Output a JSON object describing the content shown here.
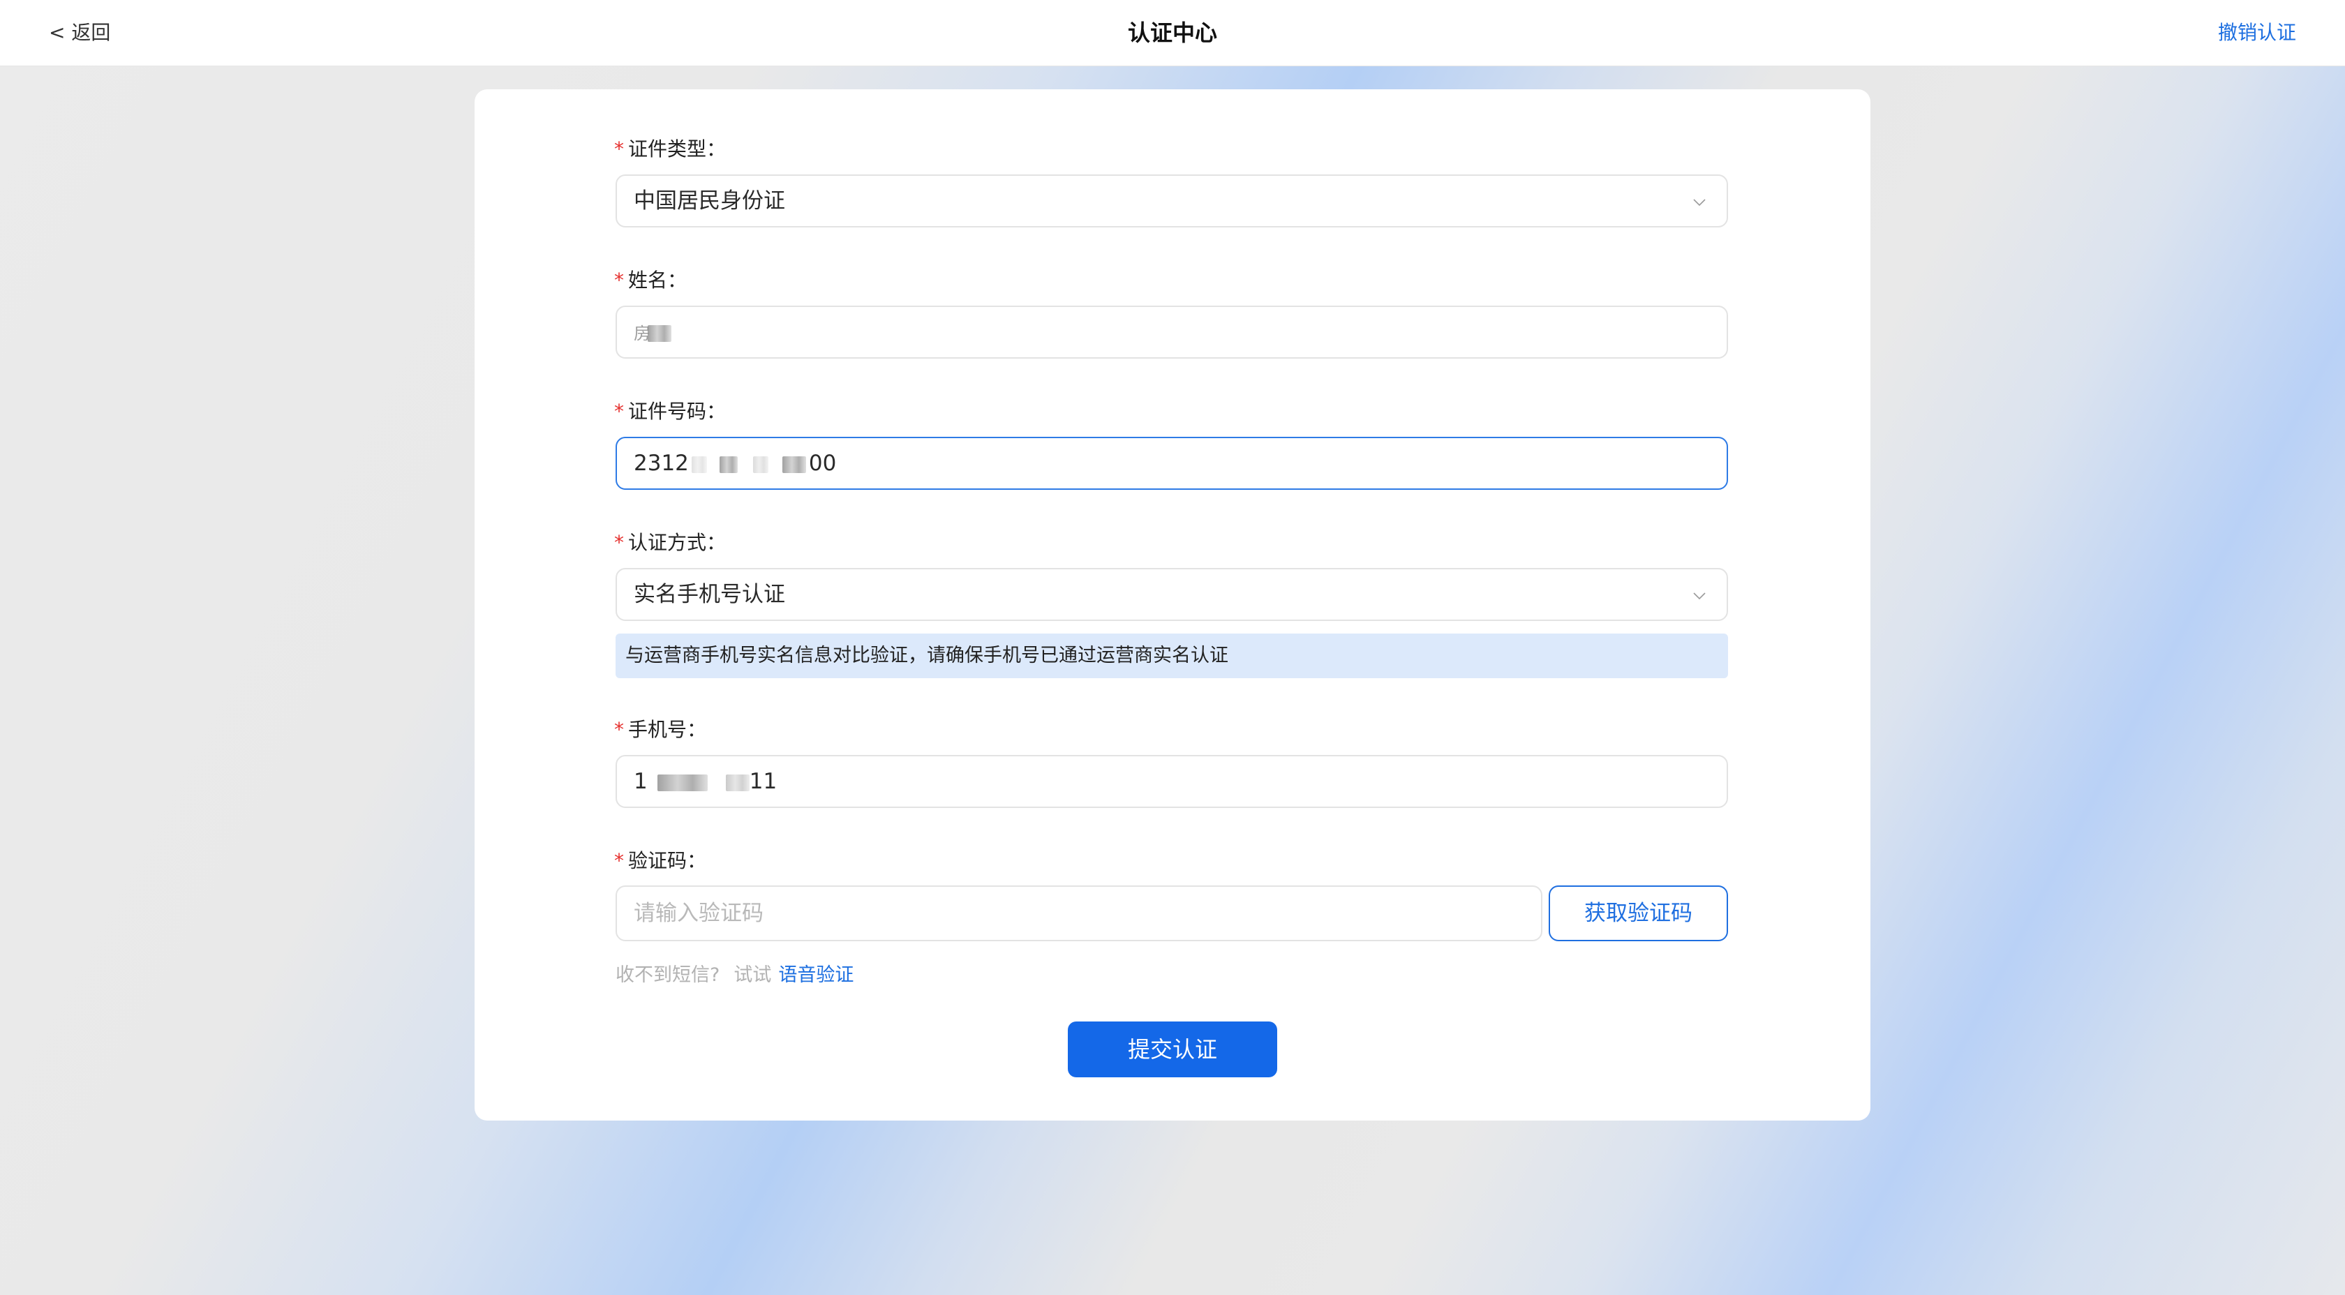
{
  "header": {
    "back_label": "< 返回",
    "title": "认证中心",
    "revoke_label": "撤销认证"
  },
  "form": {
    "required_mark": "*",
    "cert_type": {
      "label": "证件类型：",
      "value": "中国居民身份证"
    },
    "name": {
      "label": "姓名：",
      "value": "房"
    },
    "id_number": {
      "label": "证件号码：",
      "value_prefix": "2312",
      "value_suffix": "00"
    },
    "auth_method": {
      "label": "认证方式：",
      "value": "实名手机号认证",
      "hint": "与运营商手机号实名信息对比验证，请确保手机号已通过运营商实名认证"
    },
    "phone": {
      "label": "手机号：",
      "value_prefix": "1",
      "value_suffix": "11"
    },
    "verify_code": {
      "label": "验证码：",
      "placeholder": "请输入验证码",
      "get_code_label": "获取验证码",
      "no_sms_text": "收不到短信?",
      "try_text": "试试",
      "voice_link": "语音验证"
    },
    "submit_label": "提交认证"
  },
  "colors": {
    "accent": "#1468e8",
    "required": "#e5312f",
    "hint_bg": "#dce9fb"
  }
}
